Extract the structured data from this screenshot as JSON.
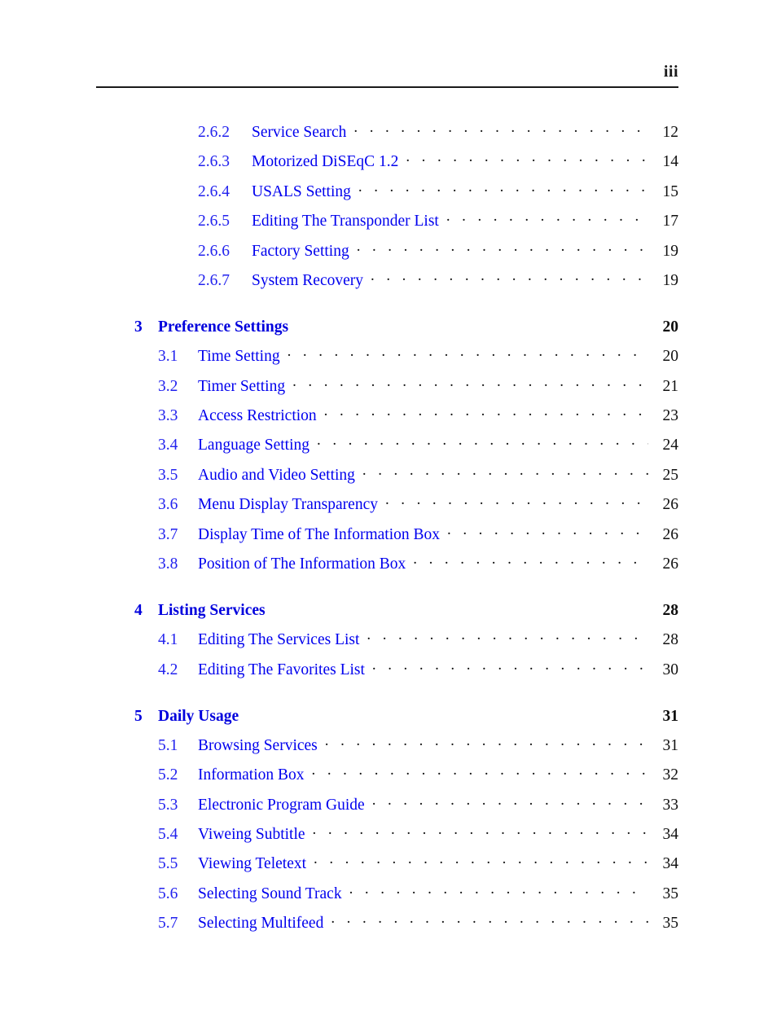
{
  "header": {
    "folio": "iii"
  },
  "toc": {
    "entries": [
      {
        "level": "subsub",
        "number": "2.6.2",
        "title": "Service Search",
        "page": "12"
      },
      {
        "level": "subsub",
        "number": "2.6.3",
        "title": "Motorized DiSEqC 1.2",
        "page": "14"
      },
      {
        "level": "subsub",
        "number": "2.6.4",
        "title": "USALS Setting",
        "page": "15"
      },
      {
        "level": "subsub",
        "number": "2.6.5",
        "title": "Editing The Transponder List",
        "page": "17"
      },
      {
        "level": "subsub",
        "number": "2.6.6",
        "title": "Factory Setting",
        "page": "19"
      },
      {
        "level": "subsub",
        "number": "2.6.7",
        "title": "System Recovery",
        "page": "19"
      },
      {
        "level": "chapter",
        "number": "3",
        "title": "Preference Settings",
        "page": "20"
      },
      {
        "level": "section",
        "number": "3.1",
        "title": "Time Setting",
        "page": "20"
      },
      {
        "level": "section",
        "number": "3.2",
        "title": "Timer Setting",
        "page": "21"
      },
      {
        "level": "section",
        "number": "3.3",
        "title": "Access Restriction",
        "page": "23"
      },
      {
        "level": "section",
        "number": "3.4",
        "title": "Language Setting",
        "page": "24"
      },
      {
        "level": "section",
        "number": "3.5",
        "title": "Audio and Video Setting",
        "page": "25"
      },
      {
        "level": "section",
        "number": "3.6",
        "title": "Menu Display Transparency",
        "page": "26"
      },
      {
        "level": "section",
        "number": "3.7",
        "title": "Display Time of The Information Box",
        "page": "26"
      },
      {
        "level": "section",
        "number": "3.8",
        "title": "Position of The Information Box",
        "page": "26"
      },
      {
        "level": "chapter",
        "number": "4",
        "title": "Listing Services",
        "page": "28"
      },
      {
        "level": "section",
        "number": "4.1",
        "title": "Editing The Services List",
        "page": "28"
      },
      {
        "level": "section",
        "number": "4.2",
        "title": "Editing The Favorites List",
        "page": "30"
      },
      {
        "level": "chapter",
        "number": "5",
        "title": "Daily Usage",
        "page": "31"
      },
      {
        "level": "section",
        "number": "5.1",
        "title": "Browsing Services",
        "page": "31"
      },
      {
        "level": "section",
        "number": "5.2",
        "title": "Information Box",
        "page": "32"
      },
      {
        "level": "section",
        "number": "5.3",
        "title": "Electronic Program Guide",
        "page": "33"
      },
      {
        "level": "section",
        "number": "5.4",
        "title": "Viweing Subtitle",
        "page": "34"
      },
      {
        "level": "section",
        "number": "5.5",
        "title": "Viewing Teletext",
        "page": "34"
      },
      {
        "level": "section",
        "number": "5.6",
        "title": "Selecting Sound Track",
        "page": "35"
      },
      {
        "level": "section",
        "number": "5.7",
        "title": "Selecting Multifeed",
        "page": "35"
      }
    ]
  },
  "colors": {
    "link_blue": "#0000EE",
    "heading_blue": "#0000DD",
    "text_black": "#111111"
  }
}
